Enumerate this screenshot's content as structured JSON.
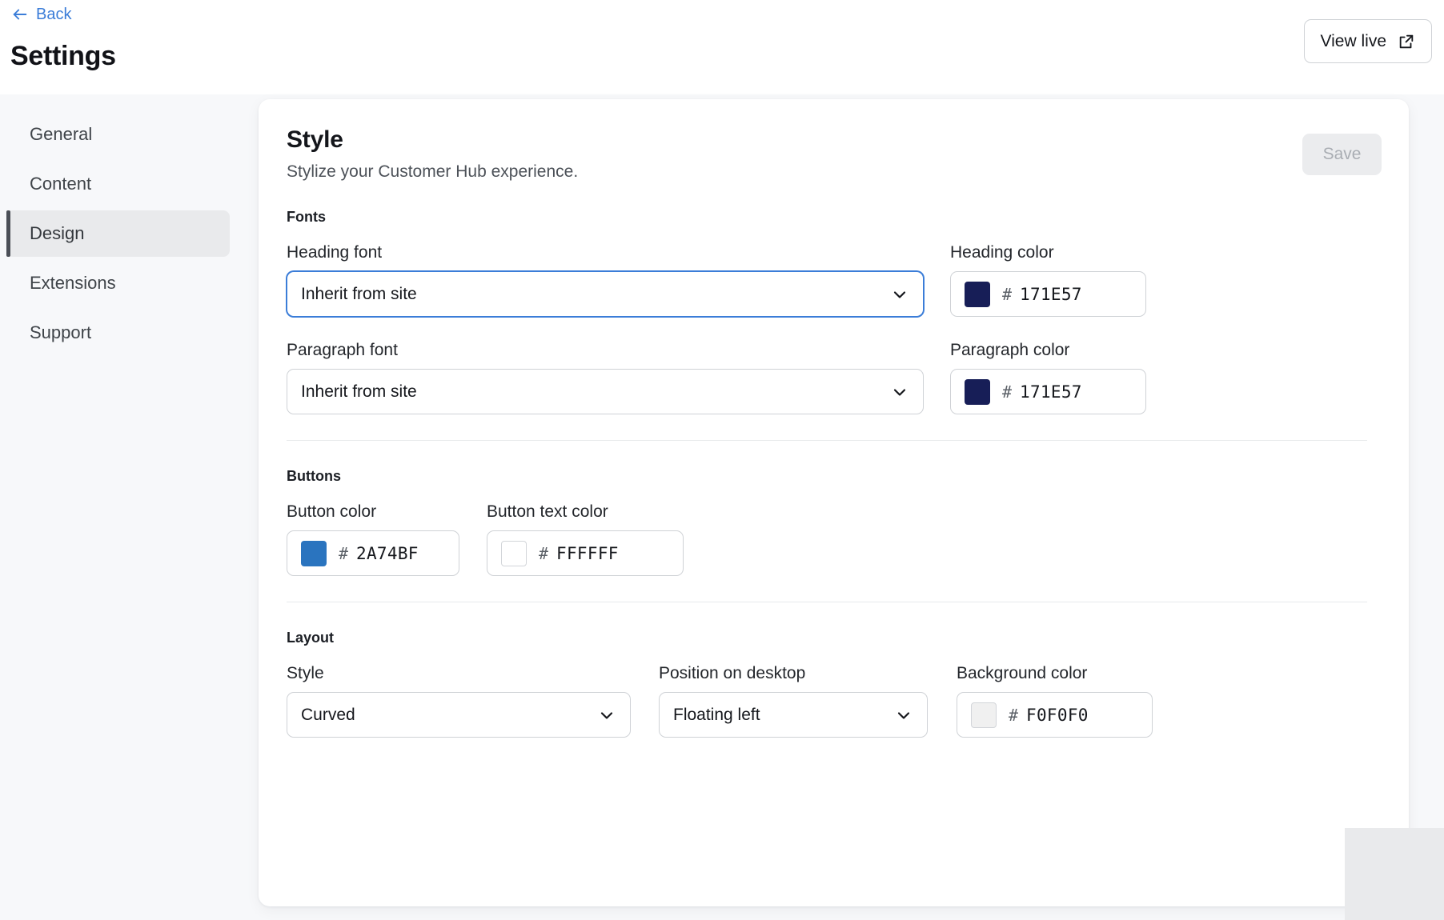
{
  "header": {
    "back_label": "Back",
    "back_icon": "arrow-left-icon",
    "title": "Settings",
    "view_live_label": "View live",
    "view_live_icon": "external-link-icon"
  },
  "sidebar": {
    "items": [
      {
        "label": "General",
        "active": false
      },
      {
        "label": "Content",
        "active": false
      },
      {
        "label": "Design",
        "active": true
      },
      {
        "label": "Extensions",
        "active": false
      },
      {
        "label": "Support",
        "active": false
      }
    ]
  },
  "panel": {
    "title": "Style",
    "subtitle": "Stylize your Customer Hub experience.",
    "save_label": "Save",
    "save_disabled": true,
    "sections": {
      "fonts": {
        "title": "Fonts",
        "heading_font": {
          "label": "Heading font",
          "value": "Inherit from site",
          "icon": "chevron-down-icon",
          "focused": true
        },
        "heading_color": {
          "label": "Heading color",
          "hash": "#",
          "value": "171E57",
          "swatch": "#171E57"
        },
        "paragraph_font": {
          "label": "Paragraph font",
          "value": "Inherit from site",
          "icon": "chevron-down-icon",
          "focused": false
        },
        "paragraph_color": {
          "label": "Paragraph color",
          "hash": "#",
          "value": "171E57",
          "swatch": "#171E57"
        }
      },
      "buttons": {
        "title": "Buttons",
        "button_color": {
          "label": "Button color",
          "hash": "#",
          "value": "2A74BF",
          "swatch": "#2A74BF"
        },
        "button_text_color": {
          "label": "Button text color",
          "hash": "#",
          "value": "FFFFFF",
          "swatch": "#FFFFFF"
        }
      },
      "layout": {
        "title": "Layout",
        "style": {
          "label": "Style",
          "value": "Curved",
          "icon": "chevron-down-icon"
        },
        "position": {
          "label": "Position on desktop",
          "value": "Floating left",
          "icon": "chevron-down-icon"
        },
        "background_color": {
          "label": "Background color",
          "hash": "#",
          "value": "F0F0F0",
          "swatch": "#F0F0F0"
        }
      }
    }
  },
  "accents": {
    "link_blue": "#3B7DD8",
    "focus_blue": "#3B7DD8",
    "active_nav_bg": "#E9EAEC",
    "active_nav_bar": "#4B4F57",
    "page_bg": "#F7F8FA"
  }
}
